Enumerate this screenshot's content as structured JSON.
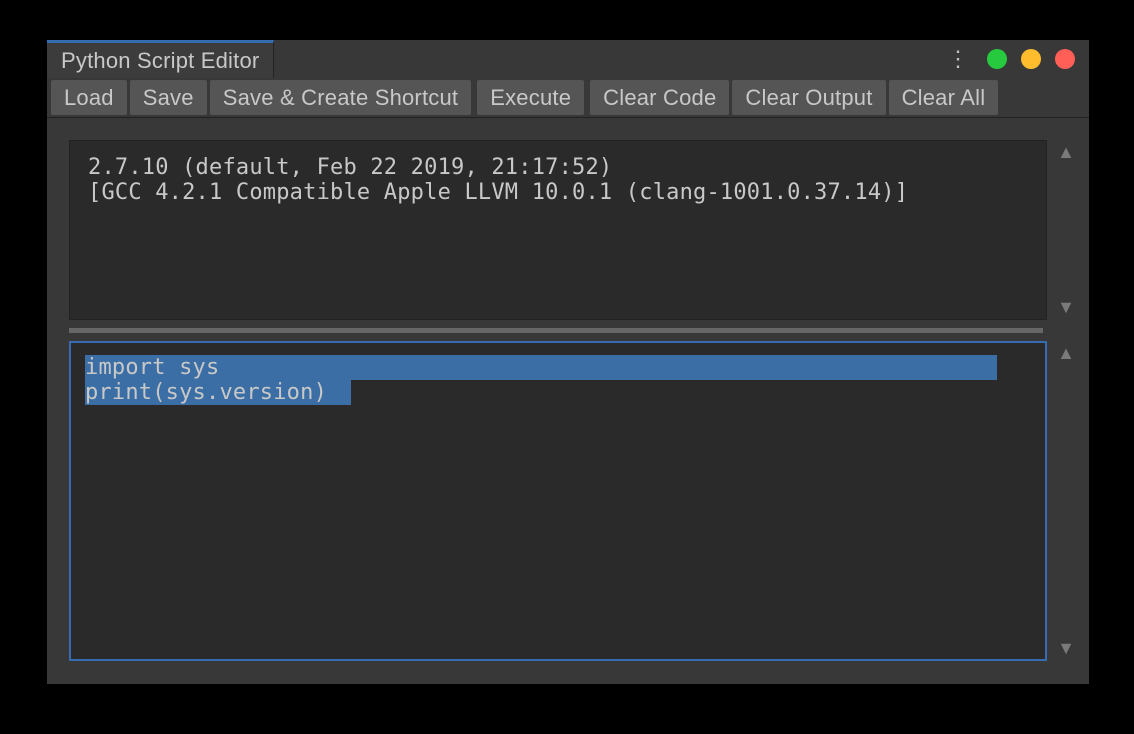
{
  "window": {
    "title": "Python Script Editor"
  },
  "toolbar": {
    "load": "Load",
    "save": "Save",
    "save_shortcut": "Save & Create Shortcut",
    "execute": "Execute",
    "clear_code": "Clear Code",
    "clear_output": "Clear Output",
    "clear_all": "Clear All"
  },
  "output": {
    "text": "2.7.10 (default, Feb 22 2019, 21:17:52)\n[GCC 4.2.1 Compatible Apple LLVM 10.0.1 (clang-1001.0.37.14)]"
  },
  "code": {
    "line1": "import sys",
    "line2": "print(sys.version)"
  }
}
